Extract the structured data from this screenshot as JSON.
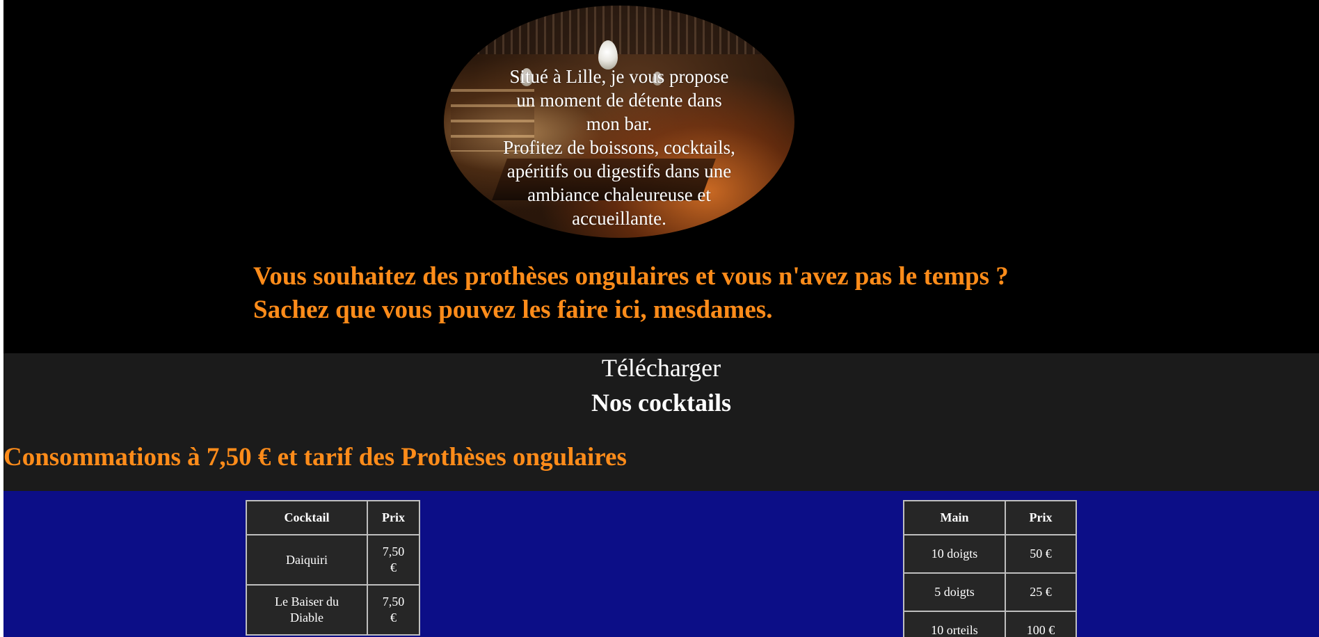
{
  "hero": {
    "intro_lines": [
      "Situé à Lille, je vous propose",
      "un moment de détente dans",
      "mon bar.",
      "Profitez de boissons, cocktails,",
      "apéritifs ou digestifs dans une",
      "ambiance chaleureuse et",
      "accueillante."
    ],
    "promo_line1": "Vous souhaitez des prothèses ongulaires et vous n'avez pas le temps ?",
    "promo_line2": "Sachez que vous pouvez les faire ici, mesdames."
  },
  "download_link": "Télécharger",
  "cocktails_title": "Nos cocktails",
  "prices_heading": "Consommations à 7,50 € et tarif des Prothèses ongulaires",
  "cocktail_table": {
    "headers": [
      "Cocktail",
      "Prix"
    ],
    "rows": [
      {
        "name_lines": [
          "Daiquiri"
        ],
        "price_lines": [
          "7,50",
          "€"
        ]
      },
      {
        "name_lines": [
          "Le Baiser du",
          "Diable"
        ],
        "price_lines": [
          "7,50",
          "€"
        ]
      }
    ]
  },
  "nails_table": {
    "headers": [
      "Main",
      "Prix"
    ],
    "rows": [
      {
        "name": "10 doigts",
        "price": "50 €"
      },
      {
        "name": "5 doigts",
        "price": "25 €"
      },
      {
        "name": "10 orteils",
        "price": "100 €"
      }
    ]
  },
  "colors": {
    "accent_orange": "#ff8c1a",
    "band_grey": "#1b1b1b",
    "section_blue": "#0c0e87",
    "table_bg": "#262626"
  }
}
